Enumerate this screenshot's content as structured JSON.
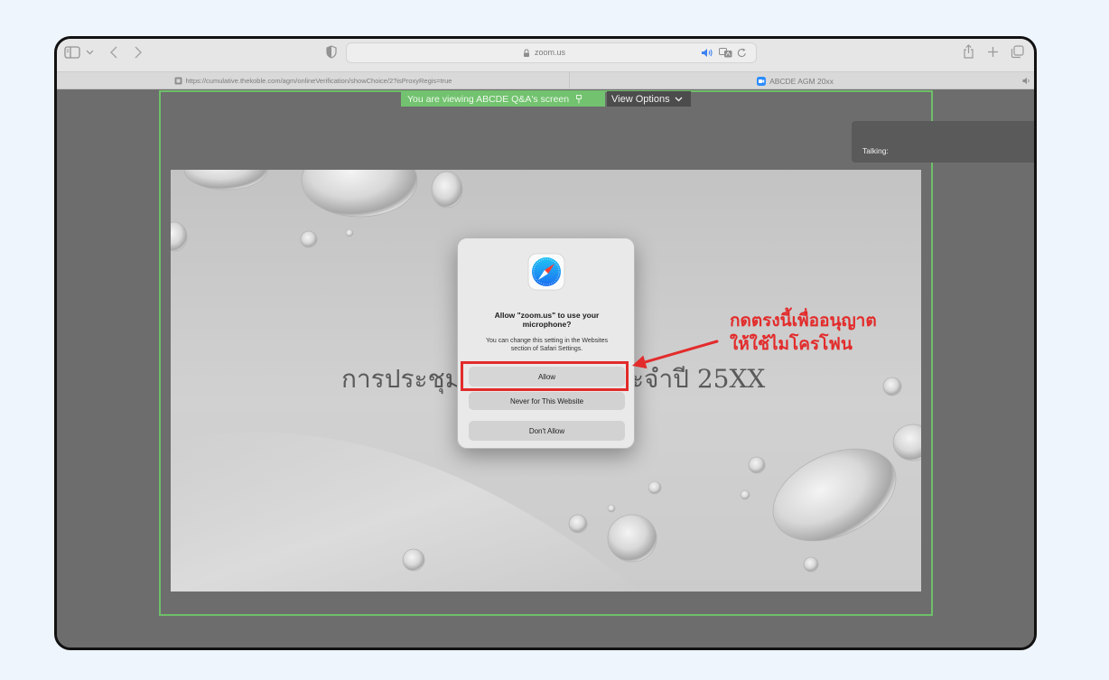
{
  "browser": {
    "address_text": "zoom.us",
    "tabs": [
      {
        "label": "https://cumulative.thekoble.com/agm/onlineVerification/showChoice/2?isProxyRegis=true",
        "icon": "page-favicon"
      },
      {
        "label": "ABCDE AGM 20xx",
        "icon": "zoom-favicon"
      }
    ],
    "toolbar_icons": [
      "sidebar-icon",
      "chevron-down-icon",
      "back-icon",
      "forward-icon",
      "privacy-shield-icon",
      "lock-icon",
      "speaker-icon",
      "translate-icon",
      "reload-icon",
      "share-icon",
      "new-tab-icon",
      "tab-overview-icon"
    ]
  },
  "zoom": {
    "share_banner": "You are viewing ABCDE Q&A's screen",
    "view_options": "View Options",
    "talking_label": "Talking:"
  },
  "slide": {
    "title_left": "การประชุม",
    "title_right": "ะจำปี 25XX"
  },
  "permission_dialog": {
    "icon": "safari-compass-icon",
    "title": "Allow \"zoom.us\" to use your microphone?",
    "message": "You can change this setting in the Websites section of Safari Settings.",
    "allow": "Allow",
    "never": "Never for This Website",
    "deny": "Don't Allow"
  },
  "annotation": {
    "line1": "กดตรงนี้เพื่ออนุญาต",
    "line2": "ให้ใช้ไมโครโฟน"
  },
  "colors": {
    "page_background": "#eef5fd",
    "share_green": "#72c26f",
    "annotation_red": "#e32b2b",
    "zoom_gray": "#6d6d6d",
    "safari_blue": "#1a8cf0"
  }
}
